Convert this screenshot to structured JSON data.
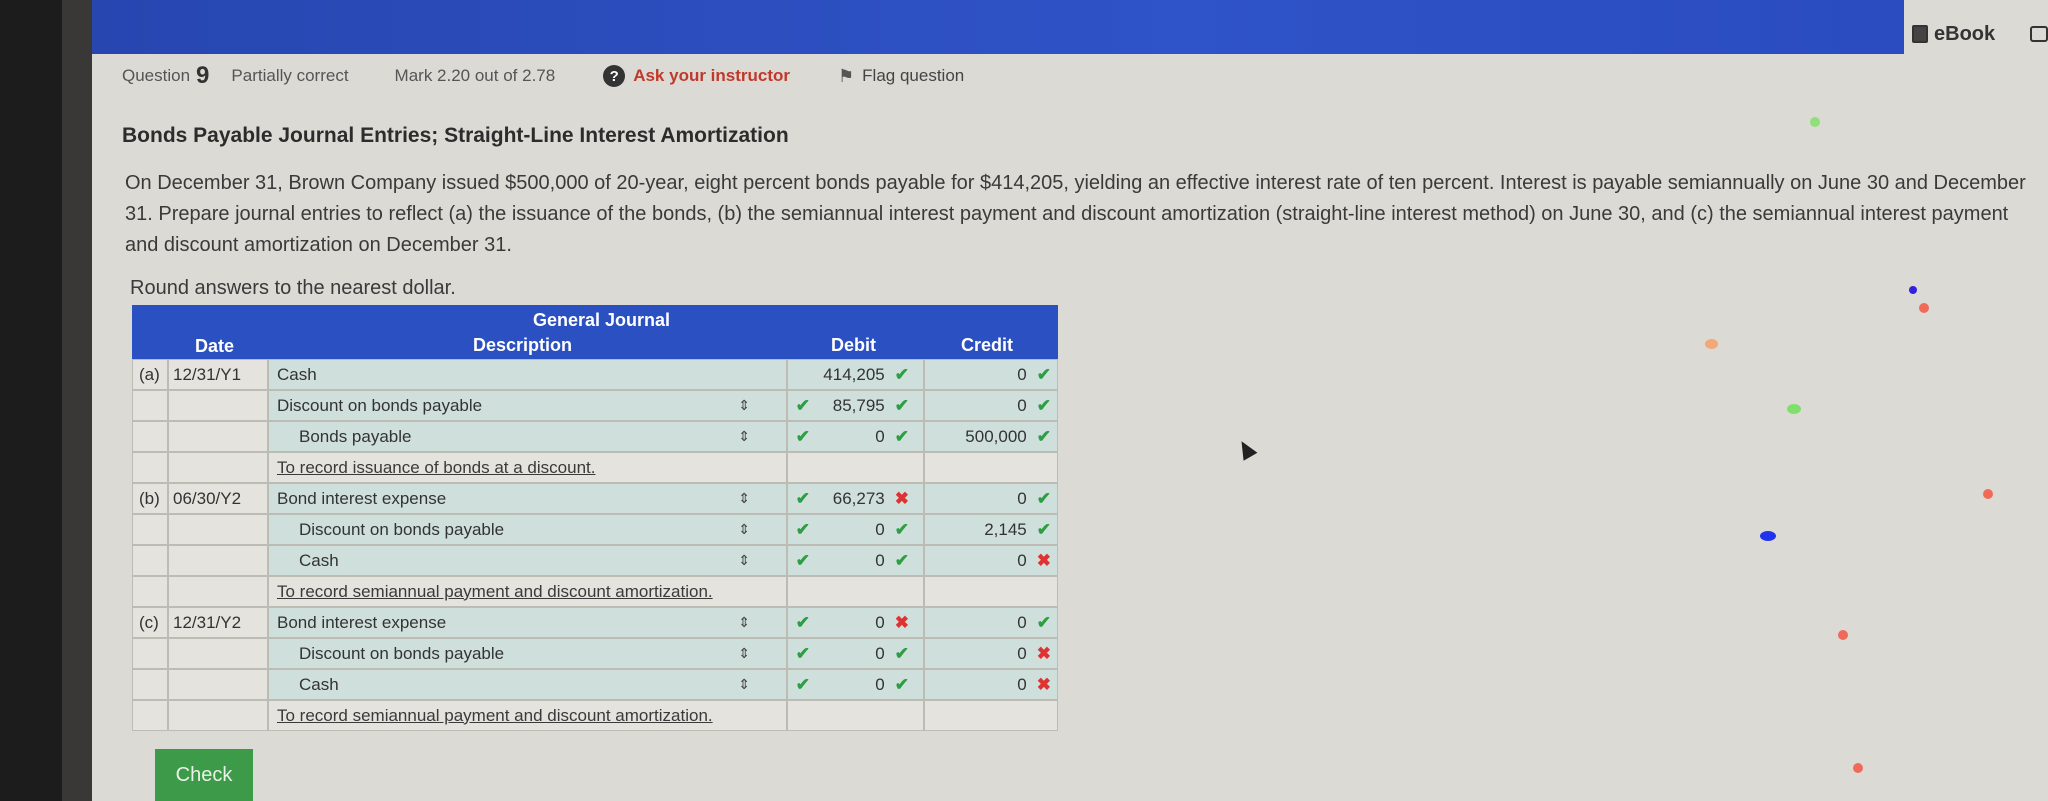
{
  "header": {
    "ebook_label": "eBook"
  },
  "question_bar": {
    "question_label": "Question",
    "question_number": "9",
    "status": "Partially correct",
    "mark": "Mark 2.20 out of 2.78",
    "ask_instructor": "Ask your instructor",
    "flag_question": "Flag question"
  },
  "problem": {
    "title": "Bonds Payable Journal Entries; Straight-Line Interest Amortization",
    "prompt": "On December 31, Brown Company issued $500,000 of 20-year, eight percent bonds payable for $414,205, yielding an effective interest rate of ten percent. Interest is payable semiannually on June 30 and December 31. Prepare journal entries to reflect (a) the issuance of the bonds, (b) the semiannual interest payment and discount amortization (straight-line interest method) on June 30, and (c) the semiannual interest payment and discount amortization on December 31.",
    "rounding": "Round answers to the nearest dollar."
  },
  "journal": {
    "title": "General Journal",
    "headers": {
      "date": "Date",
      "description": "Description",
      "debit": "Debit",
      "credit": "Credit"
    },
    "rows": [
      {
        "label": "(a)",
        "date": "12/31/Y1",
        "description": "Cash",
        "debit": "414,205",
        "debit_status": "✔",
        "credit": "0",
        "credit_status": "✔"
      },
      {
        "label": "",
        "date": "",
        "description": "Discount on bonds payable",
        "debit": "85,795",
        "debit_status": "✔",
        "credit": "0",
        "credit_status": "✔"
      },
      {
        "label": "",
        "date": "",
        "description": "Bonds payable",
        "debit": "0",
        "debit_status": "✔",
        "credit": "500,000",
        "credit_status": "✔"
      },
      {
        "label": "",
        "date": "",
        "description": "To record issuance of bonds at a discount."
      },
      {
        "label": "(b)",
        "date": "06/30/Y2",
        "description": "Bond interest expense",
        "debit": "66,273",
        "debit_status": "✖",
        "credit": "0",
        "credit_status": "✔"
      },
      {
        "label": "",
        "date": "",
        "description": "Discount on bonds payable",
        "debit": "0",
        "debit_status": "✔",
        "credit": "2,145",
        "credit_status": "✔"
      },
      {
        "label": "",
        "date": "",
        "description": "Cash",
        "debit": "0",
        "debit_status": "✔",
        "credit": "0",
        "credit_status": "✖"
      },
      {
        "label": "",
        "date": "",
        "description": "To record semiannual payment and discount amortization."
      },
      {
        "label": "(c)",
        "date": "12/31/Y2",
        "description": "Bond interest expense",
        "debit": "0",
        "debit_status": "✖",
        "credit": "0",
        "credit_status": "✔"
      },
      {
        "label": "",
        "date": "",
        "description": "Discount on bonds payable",
        "debit": "0",
        "debit_status": "✔",
        "credit": "0",
        "credit_status": "✖"
      },
      {
        "label": "",
        "date": "",
        "description": "Cash",
        "debit": "0",
        "debit_status": "✔",
        "credit": "0",
        "credit_status": "✖"
      },
      {
        "label": "",
        "date": "",
        "description": "To record semiannual payment and discount amortization."
      }
    ]
  },
  "actions": {
    "check_label": "Check"
  },
  "icons": {
    "help": "question-circle-icon",
    "flag": "flag-icon",
    "ebook": "book-icon",
    "print": "print-icon",
    "sort": "sort-arrows-icon"
  },
  "colors": {
    "header_blue": "#2b50c2",
    "correct": "#2e9e44",
    "incorrect": "#dd3333",
    "check_button": "#3d9a48"
  }
}
